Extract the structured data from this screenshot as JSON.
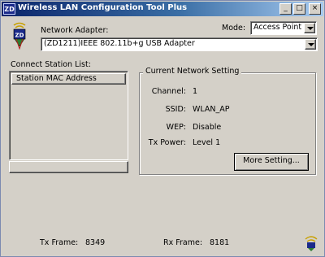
{
  "window": {
    "title": "Wireless LAN Configuration Tool Plus",
    "title_icon_text": "ZD",
    "controls": [
      "_",
      "□",
      "×"
    ]
  },
  "header": {
    "logo_text": "ZD",
    "network_adapter_label": "Network Adapter:",
    "network_adapter_value": "(ZD1211)IEEE 802.11b+g USB Adapter",
    "mode_label": "Mode:",
    "mode_value": "Access Point"
  },
  "station_list": {
    "label": "Connect Station List:",
    "column_header": "Station MAC Address",
    "rows": []
  },
  "network_setting": {
    "title": "Current Network Setting",
    "channel_label": "Channel:",
    "channel_value": "1",
    "ssid_label": "SSID:",
    "ssid_value": "WLAN_AP",
    "wep_label": "WEP:",
    "wep_value": "Disable",
    "tx_power_label": "Tx Power:",
    "tx_power_value": "Level 1",
    "more_button": "More Setting..."
  },
  "status": {
    "tx_frame_label": "Tx Frame:",
    "tx_frame_value": "8349",
    "rx_frame_label": "Rx Frame:",
    "rx_frame_value": "8181",
    "icon": "wireless-status-icon"
  },
  "colors": {
    "titlebar_start": "#0a246a",
    "titlebar_end": "#a6caf0",
    "face": "#d4d0c8"
  }
}
